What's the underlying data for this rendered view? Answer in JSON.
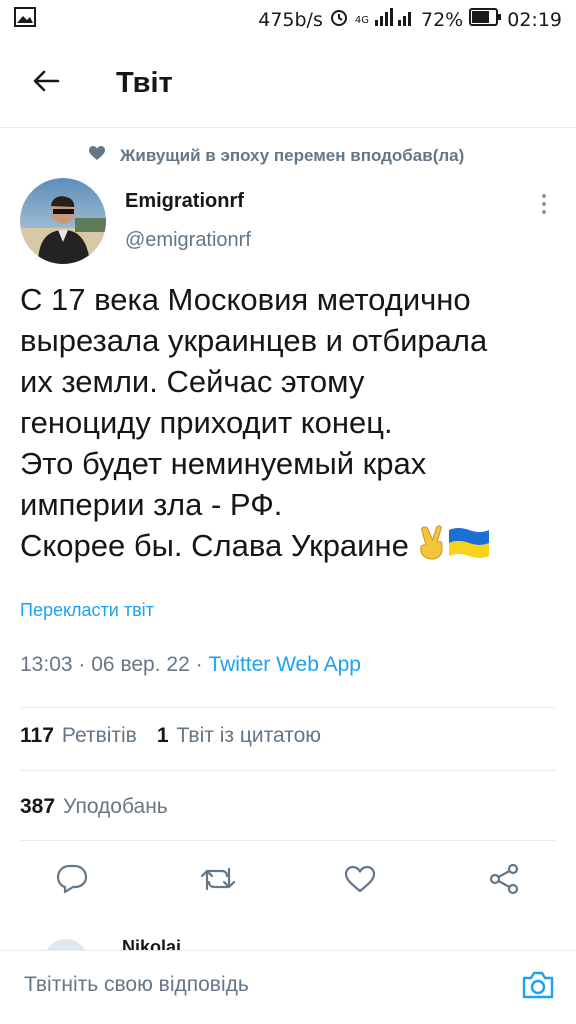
{
  "status_bar": {
    "net_speed": "475b/s",
    "network_type": "4G",
    "battery": "72%",
    "time": "02:19",
    "icons": [
      "image-icon",
      "alarm-icon",
      "signal-icon",
      "battery-icon"
    ]
  },
  "header": {
    "title": "Твіт",
    "back_icon": "arrow-left-icon"
  },
  "social_context": {
    "text": "Живущий в эпоху перемен вподобав(ла)",
    "icon": "heart-icon"
  },
  "author": {
    "name": "Emigrationrf",
    "handle": "@emigrationrf"
  },
  "tweet": {
    "lines": [
      "С 17 века Московия методично",
      "вырезала украинцев и отбирала",
      "их земли. Сейчас этому",
      "геноциду приходит конец.",
      "Это будет неминуемый крах",
      "империи зла - РФ.",
      "Скорее бы. Слава Украине"
    ],
    "emoji": [
      "victory-hand-icon",
      "ukraine-flag-icon"
    ],
    "translate_label": "Перекласти твіт",
    "time": "13:03",
    "date": "06 вер. 22",
    "separator": "·",
    "source": "Twitter Web App"
  },
  "stats": {
    "retweets_count": "117",
    "retweets_label": "Ретвітів",
    "quotes_count": "1",
    "quotes_label": "Твіт із цитатою",
    "likes_count": "387",
    "likes_label": "Уподобань"
  },
  "actions": [
    "reply-icon",
    "retweet-icon",
    "like-icon",
    "share-icon"
  ],
  "next_reply": {
    "name_partial": "Nikolaj"
  },
  "reply_bar": {
    "placeholder": "Твітніть свою відповідь",
    "camera_icon": "camera-icon"
  },
  "colors": {
    "accent": "#1da1f2",
    "text_primary": "#14171a",
    "text_secondary": "#657786",
    "divider": "#e6ecf0"
  }
}
